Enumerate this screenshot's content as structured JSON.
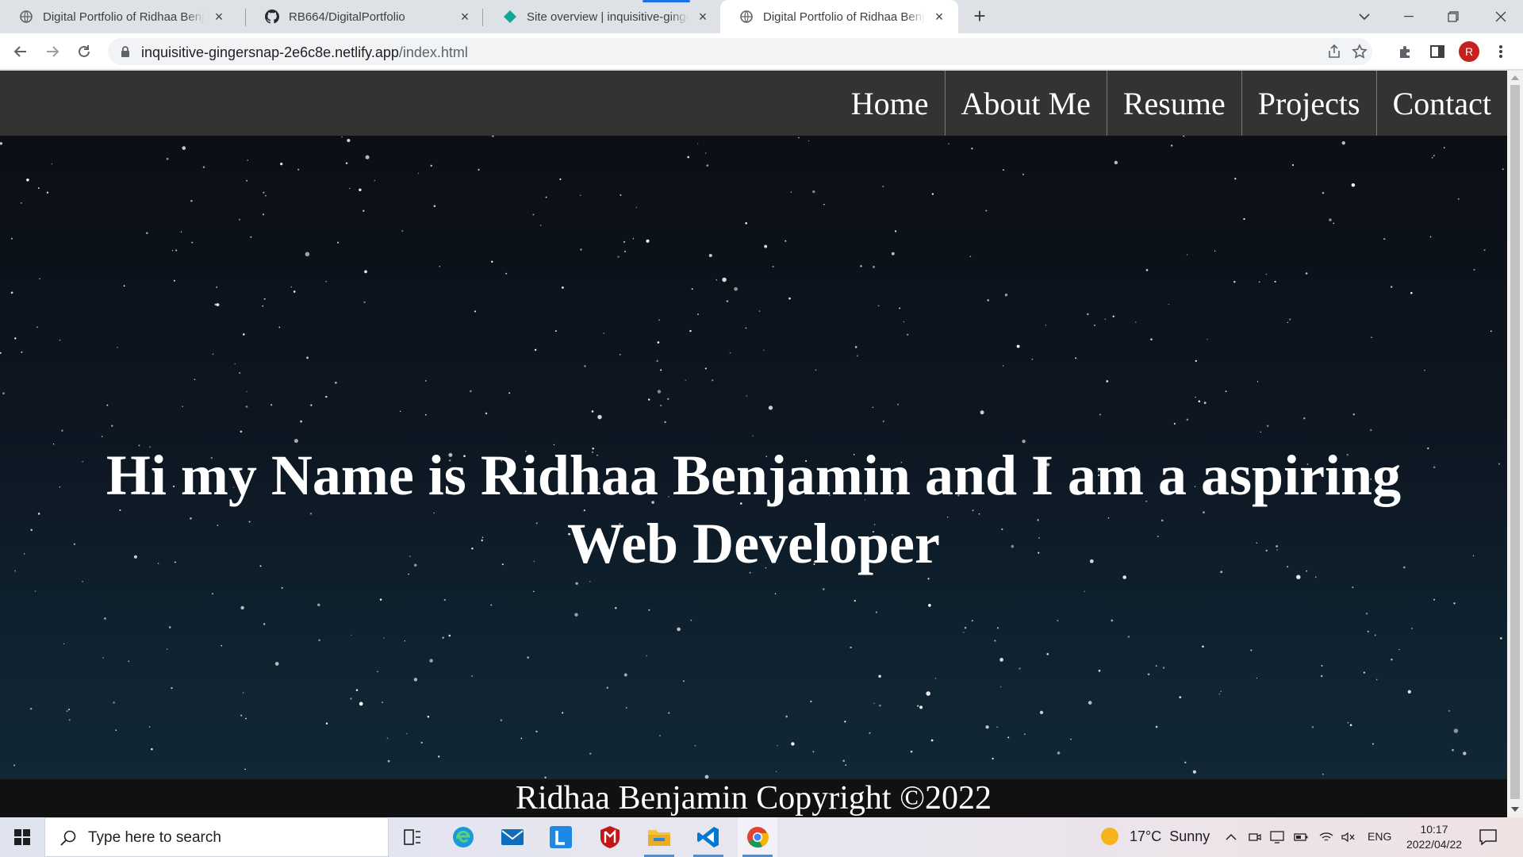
{
  "browser": {
    "tabs": [
      {
        "title": "Digital Portfolio of Ridhaa Benjamin",
        "icon": "globe-icon",
        "active": false
      },
      {
        "title": "RB664/DigitalPortfolio",
        "icon": "github-icon",
        "active": false
      },
      {
        "title": "Site overview | inquisitive-gingersnap",
        "icon": "netlify-icon",
        "active": false
      },
      {
        "title": "Digital Portfolio of Ridhaa Benjamin",
        "icon": "globe-icon",
        "active": true
      }
    ],
    "close_glyph": "×",
    "new_tab_glyph": "+",
    "url": {
      "host": "inquisitive-gingersnap-2e6c8e.netlify.app",
      "path": "/index.html"
    },
    "profile_initial": "R",
    "accent_color": "#1a73e8"
  },
  "site": {
    "nav": [
      "Home",
      "About Me",
      "Resume",
      "Projects",
      "Contact"
    ],
    "hero_text": "Hi my Name is Ridhaa Benjamin and I am a aspiring Web Developer",
    "footer_text": "Ridhaa Benjamin Copyright ©2022",
    "nav_bg": "#333333",
    "footer_bg": "#111111"
  },
  "taskbar": {
    "search_placeholder": "Type here to search",
    "apps": [
      "task-view-icon",
      "edge-icon",
      "mail-icon",
      "l-app-icon",
      "mcafee-icon",
      "file-explorer-icon",
      "vscode-icon",
      "chrome-icon"
    ],
    "weather": {
      "temp": "17°C",
      "condition": "Sunny"
    },
    "language": "ENG",
    "time": "10:17",
    "date": "2022/04/22"
  }
}
